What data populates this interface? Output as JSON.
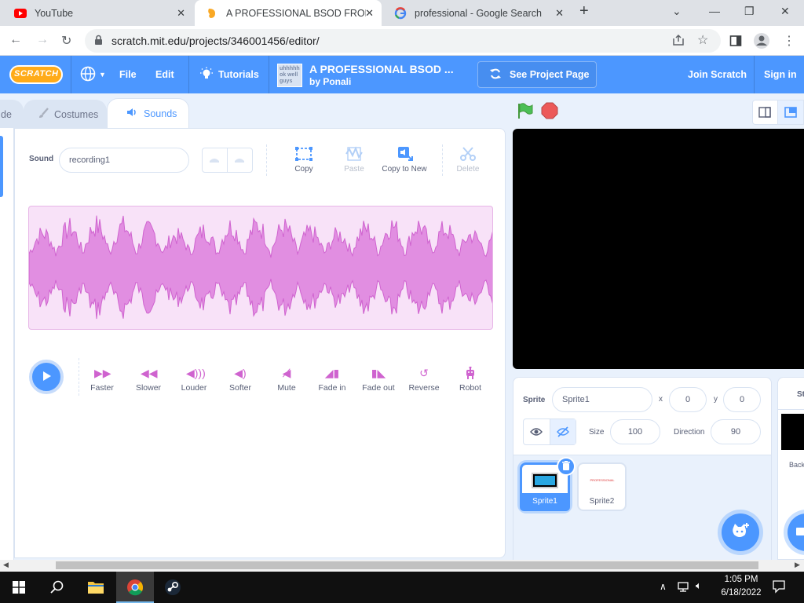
{
  "browser": {
    "tabs": [
      {
        "title": "YouTube",
        "close": "✕"
      },
      {
        "title": "A PROFESSIONAL BSOD FROM W",
        "close": "✕"
      },
      {
        "title": "professional - Google Search",
        "close": "✕"
      }
    ],
    "new_tab": "+",
    "url": "scratch.mit.edu/projects/346001456/editor/"
  },
  "menubar": {
    "logo": "SCRATCH",
    "file": "File",
    "edit": "Edit",
    "tutorials": "Tutorials",
    "project_thumb": "uhhhhh ok well guys",
    "project_title": "A PROFESSIONAL BSOD ...",
    "author": "by Ponali",
    "see_project_page": "See Project Page",
    "join": "Join Scratch",
    "signin": "Sign in"
  },
  "editor_tabs": {
    "code": "de",
    "costumes": "Costumes",
    "sounds": "Sounds"
  },
  "sound_editor": {
    "sound_label": "Sound",
    "sound_name": "recording1",
    "tools": {
      "copy": "Copy",
      "paste": "Paste",
      "copy_to_new": "Copy to New",
      "delete": "Delete"
    },
    "effects": {
      "faster": "Faster",
      "slower": "Slower",
      "louder": "Louder",
      "softer": "Softer",
      "mute": "Mute",
      "fade_in": "Fade in",
      "fade_out": "Fade out",
      "reverse": "Reverse",
      "robot": "Robot"
    }
  },
  "sprite_info": {
    "sprite_label": "Sprite",
    "sprite_name": "Sprite1",
    "x_label": "x",
    "x": "0",
    "y_label": "y",
    "y": "0",
    "size_label": "Size",
    "size": "100",
    "direction_label": "Direction",
    "direction": "90",
    "sprites": [
      "Sprite1",
      "Sprite2"
    ],
    "sprite2_thumb_text": "PROFESSIONAL"
  },
  "backdrop_pane": {
    "stage_label": "St",
    "backdrops_label": "Back"
  },
  "taskbar": {
    "time": "1:05 PM",
    "date": "6/18/2022"
  },
  "colors": {
    "scratch_blue": "#4c97ff",
    "sound_purple": "#cf63cf",
    "wave_fill": "#e18ee1",
    "wave_bg": "#f8e2f8"
  }
}
